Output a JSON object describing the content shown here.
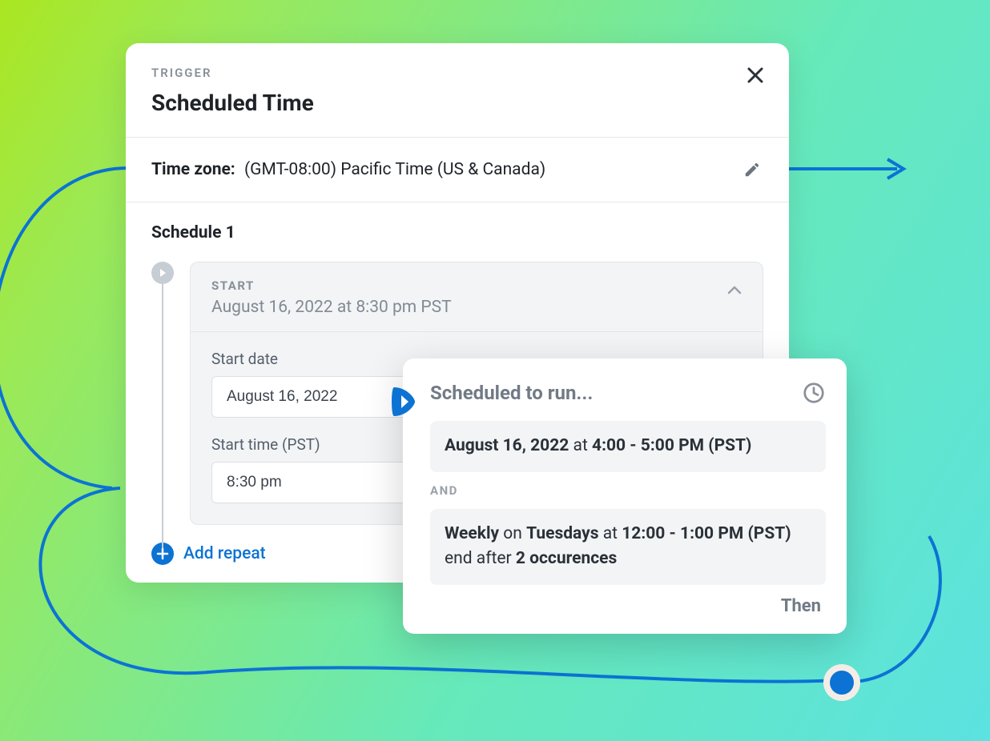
{
  "panel": {
    "kicker": "TRIGGER",
    "title": "Scheduled Time"
  },
  "timezone": {
    "label": "Time zone:",
    "value": "(GMT-08:00) Pacific Time (US & Canada)"
  },
  "schedule": {
    "title": "Schedule 1",
    "start_label": "START",
    "start_summary": "August 16, 2022 at 8:30 pm PST",
    "start_date_label": "Start date",
    "start_date_value": "August 16, 2022",
    "start_time_label": "Start time (PST)",
    "start_time_value": "8:30 pm"
  },
  "add_repeat": "Add repeat",
  "popup": {
    "title": "Scheduled to run...",
    "and_label": "AND",
    "then_label": "Then",
    "entry1": {
      "date": "August 16, 2022",
      "at": " at ",
      "time": "4:00 - 5:00 PM (PST)"
    },
    "entry2": {
      "freq": "Weekly",
      "on": " on ",
      "day": "Tuesdays",
      "at": " at ",
      "time": "12:00 - 1:00 PM (PST)",
      "end": " end after ",
      "count": "2 occurences"
    }
  }
}
